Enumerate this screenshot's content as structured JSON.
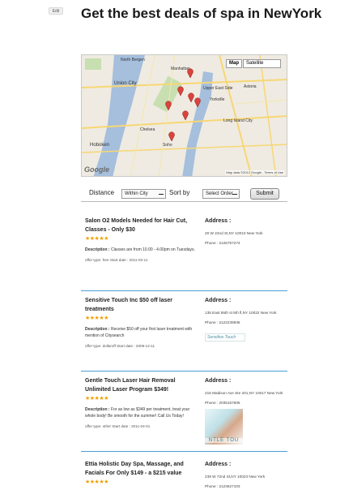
{
  "header": {
    "edit_label": "Edit",
    "title": "Get the best deals of spa in NewYork"
  },
  "map": {
    "map_button": "Map",
    "satellite_button": "Satellite",
    "logo": "Google",
    "attribution": "Map data ©2012 Google - Terms of Use",
    "place_labels": [
      "North Bergen",
      "Union City",
      "Manhattan",
      "Upper East Side",
      "Yorkville",
      "Hoboken",
      "Chelsea",
      "Soho",
      "Long Island City",
      "Astoria"
    ],
    "marker_color": "#d9443c",
    "water_color": "#a5bfdd",
    "land_color": "#efebe2",
    "road_color": "#f7d774"
  },
  "filters": {
    "distance_label": "Distance",
    "distance_value": "Within City",
    "sort_label": "Sort by",
    "sort_value": "Select Order",
    "submit_label": "Submit"
  },
  "deals": [
    {
      "title": "Salon O2 Models Needed for Hair Cut, Classes - Only $30",
      "stars": "★★★★★",
      "desc_label": "Description :",
      "desc_text": "Classes are from 10.00 - 4.00pm on Tuesdays.",
      "meta": "offer type: free Start date : 2011-03-11",
      "address_title": "Address :",
      "address": "20 W 22nd St,NY 10010 New York",
      "phone": "Phone : 2126757274",
      "image": ""
    },
    {
      "title": "Sensitive Touch Inc $50 off laser treatments",
      "stars": "★★★★★",
      "desc_label": "Description :",
      "desc_text": "Receive $50 off your first laser treatment with mention of Citysearch",
      "meta": "offer type: dollaroff Start date : 2009-12-11",
      "address_title": "Address :",
      "address": "135 East 55th st 5th fl,NY 10022 New York",
      "phone": "Phone : 2122239936",
      "image": "Sensitive Touch"
    },
    {
      "title": "Gentle Touch Laser Hair Removal Unlimited Laser Program $349!",
      "stars": "★★★★★",
      "desc_label": "Description :",
      "desc_text": "For as low as $349 per treatment, treat your whole body! Be smooth for the summer! Call Us Today!",
      "meta": "offer type: other Start date : 2011-04-01",
      "address_title": "Address :",
      "address": "215 Madison Ave Ste 201,NY 10017 New York",
      "phone": "Phone : 2035167605",
      "image": "NTLE TOU"
    },
    {
      "title": "Ettia Holistic Day Spa, Massage, and Facials For Only $149 - a $215 value",
      "stars": "★★★★★",
      "desc_label": "",
      "desc_text": "",
      "meta": "",
      "address_title": "Address :",
      "address": "239 W 72nd St,NY 10023 New York",
      "phone": "Phone : 2123627103",
      "image": ""
    }
  ]
}
